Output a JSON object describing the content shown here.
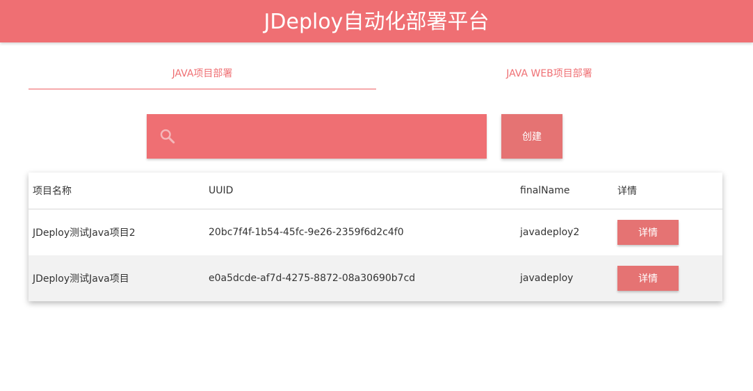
{
  "header": {
    "title": "JDeploy自动化部署平台"
  },
  "tabs": [
    {
      "label": "JAVA项目部署",
      "active": true
    },
    {
      "label": "JAVA WEB项目部署",
      "active": false
    }
  ],
  "search": {
    "value": "",
    "placeholder": ""
  },
  "toolbar": {
    "create_label": "创建"
  },
  "table": {
    "headers": {
      "name": "项目名称",
      "uuid": "UUID",
      "final_name": "finalName",
      "detail": "详情"
    },
    "rows": [
      {
        "name": "JDeploy测试Java项目2",
        "uuid": "20bc7f4f-1b54-45fc-9e26-2359f6d2c4f0",
        "final_name": "javadeploy2",
        "detail_label": "详情"
      },
      {
        "name": "JDeploy测试Java项目",
        "uuid": "e0a5dcde-af7d-4275-8872-08a30690b7cd",
        "final_name": "javadeploy",
        "detail_label": "详情"
      }
    ]
  },
  "colors": {
    "accent": "#ef6f73",
    "button": "#e57373",
    "tab_indicator": "#f6a9ab"
  },
  "icons": {
    "search": "search-icon"
  }
}
